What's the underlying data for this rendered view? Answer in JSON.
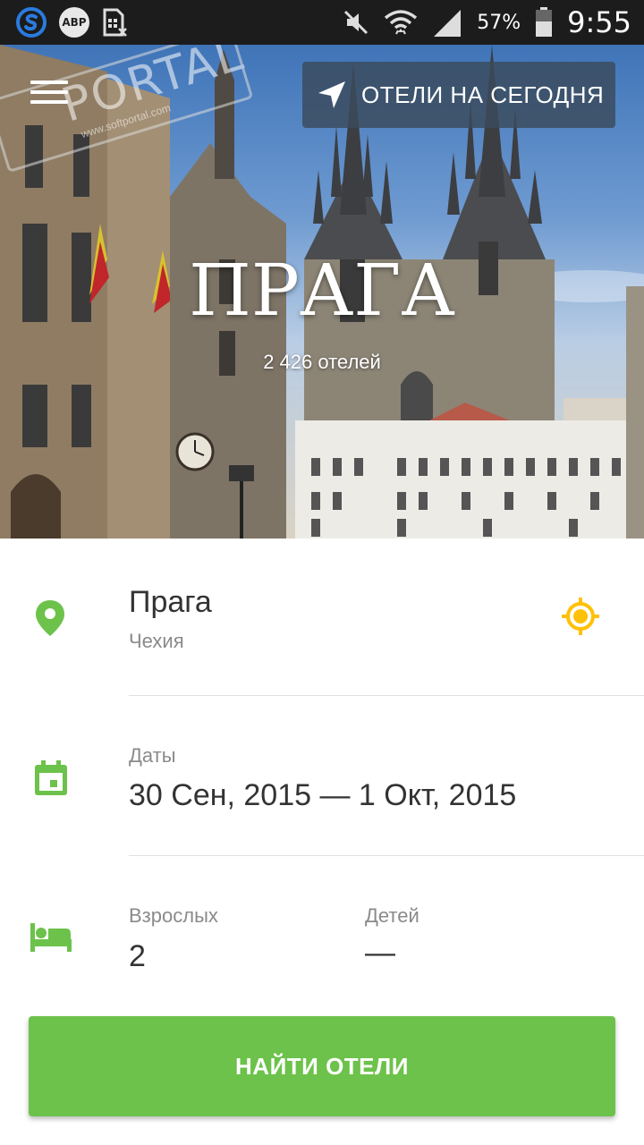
{
  "status_bar": {
    "left_icons": [
      "skype-icon",
      "adblock-icon",
      "sim-card-icon"
    ],
    "abp_text": "ABP",
    "right_icons": [
      "mute-icon",
      "wifi-icon",
      "signal-icon",
      "battery-icon"
    ],
    "battery": "57%",
    "time": "9:55"
  },
  "watermark": {
    "text": "PORTAL",
    "sub": "www.softportal.com"
  },
  "hero": {
    "hotels_today_label": "ОТЕЛИ НА СЕГОДНЯ",
    "city": "ПРАГА",
    "hotel_count": "2 426 отелей"
  },
  "search": {
    "destination": {
      "city": "Прага",
      "country": "Чехия"
    },
    "dates": {
      "label": "Даты",
      "value": "30 Сен, 2015 — 1 Окт, 2015"
    },
    "guests": {
      "adults_label": "Взрослых",
      "adults_value": "2",
      "children_label": "Детей",
      "children_value": "—"
    },
    "submit_label": "НАЙТИ ОТЕЛИ"
  },
  "colors": {
    "accent_green": "#6cc24a",
    "locate_yellow": "#ffc107",
    "status_bar": "#1c1c1c"
  }
}
